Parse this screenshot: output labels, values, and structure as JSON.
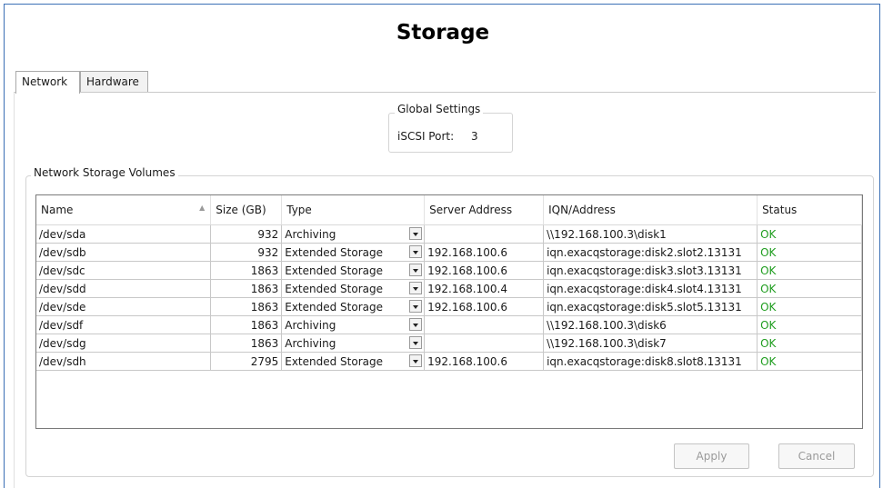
{
  "title": "Storage",
  "tabs": [
    "Network",
    "Hardware"
  ],
  "global_settings": {
    "title": "Global Settings",
    "iscsi_port_label": "iSCSI Port:",
    "iscsi_port_value": "3"
  },
  "volumes": {
    "title": "Network Storage Volumes",
    "columns": [
      "Name",
      "Size (GB)",
      "Type",
      "Server Address",
      "IQN/Address",
      "Status"
    ],
    "rows": [
      {
        "name": "/dev/sda",
        "size": "932",
        "type": "Archiving",
        "server": "",
        "iqn": "\\\\192.168.100.3\\disk1",
        "status": "OK"
      },
      {
        "name": "/dev/sdb",
        "size": "932",
        "type": "Extended Storage",
        "server": "192.168.100.6",
        "iqn": "iqn.exacqstorage:disk2.slot2.13131",
        "status": "OK"
      },
      {
        "name": "/dev/sdc",
        "size": "1863",
        "type": "Extended Storage",
        "server": "192.168.100.6",
        "iqn": "iqn.exacqstorage:disk3.slot3.13131",
        "status": "OK"
      },
      {
        "name": "/dev/sdd",
        "size": "1863",
        "type": "Extended Storage",
        "server": "192.168.100.4",
        "iqn": "iqn.exacqstorage:disk4.slot4.13131",
        "status": "OK"
      },
      {
        "name": "/dev/sde",
        "size": "1863",
        "type": "Extended Storage",
        "server": "192.168.100.6",
        "iqn": "iqn.exacqstorage:disk5.slot5.13131",
        "status": "OK"
      },
      {
        "name": "/dev/sdf",
        "size": "1863",
        "type": "Archiving",
        "server": "",
        "iqn": "\\\\192.168.100.3\\disk6",
        "status": "OK"
      },
      {
        "name": "/dev/sdg",
        "size": "1863",
        "type": "Archiving",
        "server": "",
        "iqn": "\\\\192.168.100.3\\disk7",
        "status": "OK"
      },
      {
        "name": "/dev/sdh",
        "size": "2795",
        "type": "Extended Storage",
        "server": "192.168.100.6",
        "iqn": "iqn.exacqstorage:disk8.slot8.13131",
        "status": "OK"
      }
    ]
  },
  "buttons": {
    "apply": "Apply",
    "cancel": "Cancel"
  },
  "colors": {
    "frame_border": "#3b6fb5",
    "status_ok": "#1f9d1f"
  }
}
